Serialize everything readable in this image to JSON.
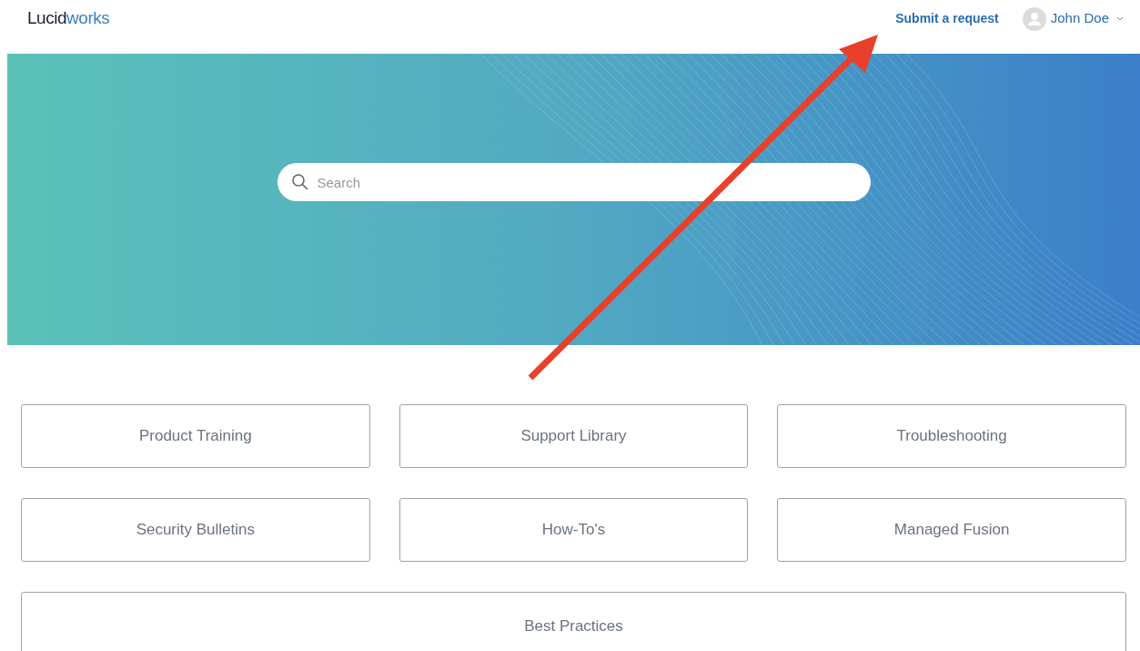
{
  "header": {
    "logo": [
      "Lucid",
      "works"
    ],
    "submit_link": "Submit a request",
    "user": {
      "name": "John Doe"
    }
  },
  "search": {
    "placeholder": "Search"
  },
  "categories": [
    {
      "label": "Product Training",
      "wide": false
    },
    {
      "label": "Support Library",
      "wide": false
    },
    {
      "label": "Troubleshooting",
      "wide": false
    },
    {
      "label": "Security Bulletins",
      "wide": false
    },
    {
      "label": "How-To's",
      "wide": false
    },
    {
      "label": "Managed Fusion",
      "wide": false
    },
    {
      "label": "Best Practices",
      "wide": true
    }
  ]
}
